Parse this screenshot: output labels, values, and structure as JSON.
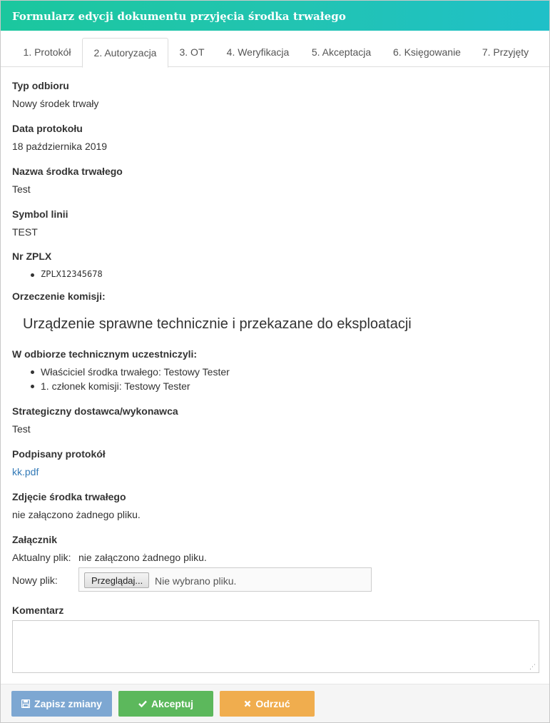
{
  "window": {
    "title": "Formularz edycji dokumentu przyjęcia środka trwałego"
  },
  "tabs": [
    {
      "label": "1. Protokół",
      "active": false
    },
    {
      "label": "2. Autoryzacja",
      "active": true
    },
    {
      "label": "3. OT",
      "active": false
    },
    {
      "label": "4. Weryfikacja",
      "active": false
    },
    {
      "label": "5. Akceptacja",
      "active": false
    },
    {
      "label": "6. Księgowanie",
      "active": false
    },
    {
      "label": "7. Przyjęty",
      "active": false
    }
  ],
  "fields": {
    "receipt_type": {
      "label": "Typ odbioru",
      "value": "Nowy środek trwały"
    },
    "protocol_date": {
      "label": "Data protokołu",
      "value": "18 października 2019"
    },
    "asset_name": {
      "label": "Nazwa środka trwałego",
      "value": "Test"
    },
    "line_symbol": {
      "label": "Symbol linii",
      "value": "TEST"
    },
    "zplx": {
      "label": "Nr ZPLX",
      "items": [
        "ZPLX12345678"
      ]
    },
    "commission_verdict": {
      "label": "Orzeczenie komisji:",
      "value": "Urządzenie sprawne technicznie i przekazane do eksploatacji"
    },
    "participants": {
      "label": "W odbiorze technicznym uczestniczyli:",
      "items": [
        "Właściciel środka trwałego: Testowy Tester",
        "1. członek komisji: Testowy Tester"
      ]
    },
    "supplier": {
      "label": "Strategiczny dostawca/wykonawca",
      "value": "Test"
    },
    "signed_protocol": {
      "label": "Podpisany protokół",
      "value": "kk.pdf"
    },
    "asset_photo": {
      "label": "Zdjęcie środka trwałego",
      "value": "nie załączono żadnego pliku."
    },
    "attachment": {
      "label": "Załącznik",
      "current_label": "Aktualny plik:",
      "current_value": "nie załączono żadnego pliku.",
      "new_label": "Nowy plik:",
      "browse_label": "Przeglądaj...",
      "no_file_text": "Nie wybrano pliku."
    },
    "comment": {
      "label": "Komentarz",
      "value": ""
    }
  },
  "footer": {
    "save_label": "Zapisz zmiany",
    "accept_label": "Akceptuj",
    "reject_label": "Odrzuć"
  },
  "colors": {
    "title_gradient_start": "#1bc79e",
    "title_gradient_end": "#1fc0c8",
    "link": "#337ab7",
    "save": "#7da7d2",
    "accept": "#5cb85c",
    "reject": "#f0ad4e"
  },
  "icons": {
    "save": "floppy-disk-icon",
    "accept": "check-icon",
    "reject": "x-icon",
    "resize": "resize-grip-icon"
  }
}
